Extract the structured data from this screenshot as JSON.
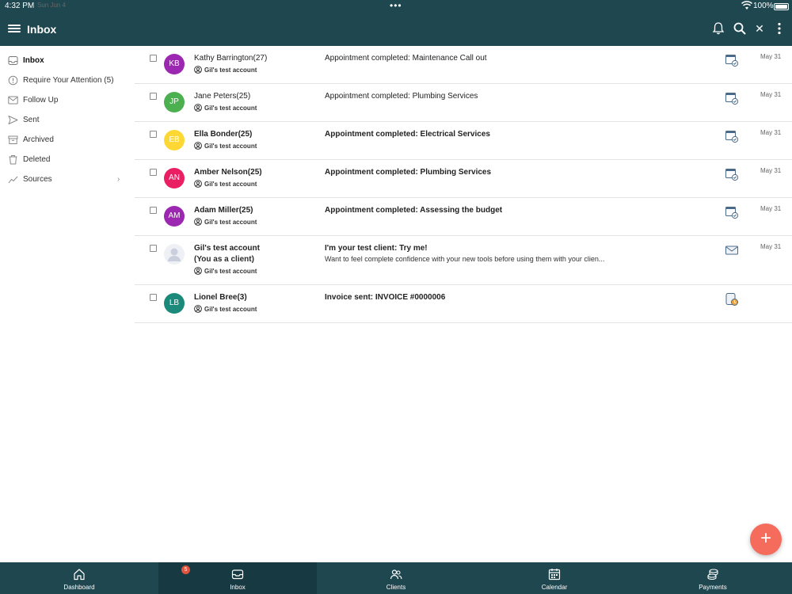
{
  "status_bar": {
    "time": "4:32 PM",
    "date": "Sun Jun 4",
    "battery": "100%"
  },
  "header": {
    "title": "Inbox"
  },
  "sidebar": {
    "items": [
      {
        "label": "Inbox",
        "icon": "inbox-icon"
      },
      {
        "label": "Require Your Attention (5)",
        "icon": "alert-icon"
      },
      {
        "label": "Follow Up",
        "icon": "follow-up-icon"
      },
      {
        "label": "Sent",
        "icon": "send-icon"
      },
      {
        "label": "Archived",
        "icon": "archive-icon"
      },
      {
        "label": "Deleted",
        "icon": "trash-icon"
      },
      {
        "label": "Sources",
        "icon": "chart-icon"
      }
    ]
  },
  "messages": [
    {
      "initials": "KB",
      "avatar_color": "#9c27b0",
      "name": "Kathy Barrington",
      "count": "(27)",
      "account": "Gil's test account",
      "subject": "Appointment completed: Maintenance Call out",
      "preview": "",
      "date": "May 31",
      "type_icon": "calendar-check-icon",
      "unread": false
    },
    {
      "initials": "JP",
      "avatar_color": "#4caf50",
      "name": "Jane Peters",
      "count": "(25)",
      "account": "Gil's test account",
      "subject": "Appointment completed: Plumbing Services",
      "preview": "",
      "date": "May 31",
      "type_icon": "calendar-check-icon",
      "unread": false
    },
    {
      "initials": "EB",
      "avatar_color": "#fdd835",
      "name": "Ella Bonder",
      "count": "(25)",
      "account": "Gil's test account",
      "subject": "Appointment completed: Electrical Services",
      "preview": "",
      "date": "May 31",
      "type_icon": "calendar-check-icon",
      "unread": true
    },
    {
      "initials": "AN",
      "avatar_color": "#e91e63",
      "name": "Amber Nelson",
      "count": "(25)",
      "account": "Gil's test account",
      "subject": "Appointment completed: Plumbing Services",
      "preview": "",
      "date": "May 31",
      "type_icon": "calendar-check-icon",
      "unread": true
    },
    {
      "initials": "AM",
      "avatar_color": "#9c27b0",
      "name": "Adam Miller",
      "count": "(25)",
      "account": "Gil's test account",
      "subject": "Appointment completed: Assessing the budget",
      "preview": "",
      "date": "May 31",
      "type_icon": "calendar-check-icon",
      "unread": true
    },
    {
      "initials": "",
      "avatar_color": "#eef0f5",
      "name": "Gil's test account",
      "name_line2": "(You as a client)",
      "count": "",
      "account": "Gil's test account",
      "subject": "I'm your test client: Try me!",
      "preview": "Want to feel complete confidence with your new tools before using them with your clien...",
      "date": "May 31",
      "type_icon": "envelope-icon",
      "unread": true
    },
    {
      "initials": "LB",
      "avatar_color": "#1b8a7a",
      "name": "Lionel Bree",
      "count": "(3)",
      "account": "Gil's test account",
      "subject": "Invoice sent: INVOICE #0000006",
      "preview": "",
      "date": "",
      "type_icon": "invoice-clock-icon",
      "unread": true
    }
  ],
  "tabs": [
    {
      "label": "Dashboard",
      "icon": "home-icon"
    },
    {
      "label": "Inbox",
      "icon": "inbox-tab-icon",
      "badge": "5"
    },
    {
      "label": "Clients",
      "icon": "clients-icon"
    },
    {
      "label": "Calendar",
      "icon": "calendar-icon"
    },
    {
      "label": "Payments",
      "icon": "payments-icon"
    }
  ],
  "colors": {
    "header_bg": "#1f4750",
    "fab": "#f56b5c",
    "badge": "#e0533f"
  }
}
